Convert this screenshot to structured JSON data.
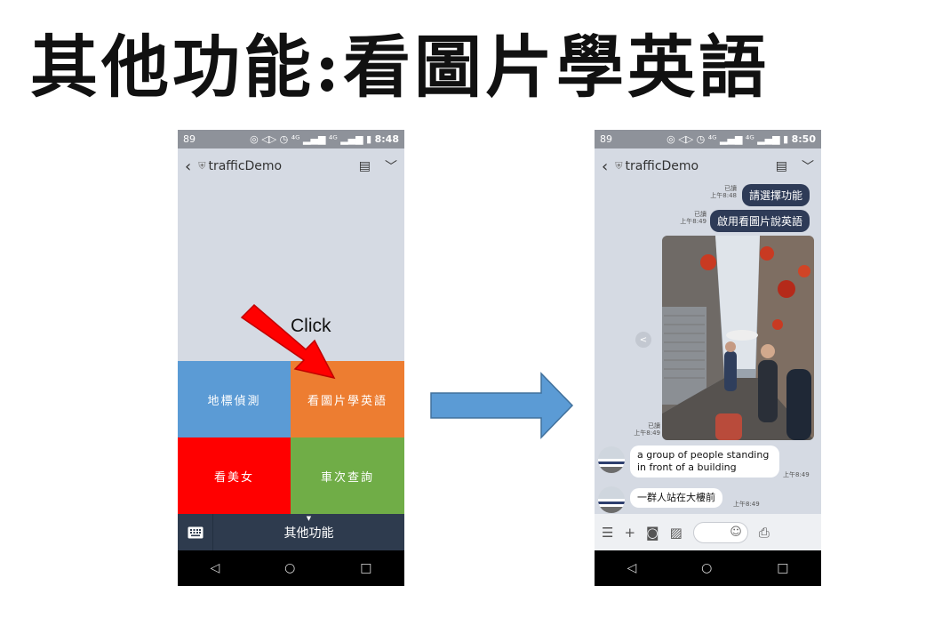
{
  "slide": {
    "title": "其他功能:看圖片學英語"
  },
  "annotation": {
    "click_text": "Click"
  },
  "left_phone": {
    "status": {
      "battery_left": "89",
      "icons": "◎ ◁▷ ◷ ⁴ᴳ ▂▄▆ ⁴ᴳ ▂▄▆ ▮",
      "time": "8:48"
    },
    "header": {
      "back": "‹",
      "shield": "⛨",
      "title": "trafficDemo",
      "note_icon": "▤",
      "chevron": "﹀"
    },
    "menu": [
      {
        "label": "地標偵測",
        "color": "#5b9bd5"
      },
      {
        "label": "看圖片學英語",
        "color": "#ed7d31"
      },
      {
        "label": "看美女",
        "color": "#ff0000"
      },
      {
        "label": "車次查詢",
        "color": "#70ad47"
      }
    ],
    "menu_bar": {
      "label": "其他功能",
      "caret": "▼"
    },
    "nav": {
      "back": "◁",
      "home": "○",
      "recent": "□"
    }
  },
  "right_phone": {
    "status": {
      "battery_left": "89",
      "icons": "◎ ◁▷ ◷ ⁴ᴳ ▂▄▆ ⁴ᴳ ▂▄▆ ▮",
      "time": "8:50"
    },
    "header": {
      "back": "‹",
      "shield": "⛨",
      "title": "trafficDemo",
      "note_icon": "▤",
      "chevron": "﹀"
    },
    "messages": {
      "m1": {
        "text": "請選擇功能",
        "read": "已讀",
        "time": "上午8:48"
      },
      "m2": {
        "text": "啟用看圖片說英語",
        "read": "已讀",
        "time": "上午8:49"
      },
      "photo": {
        "read": "已讀",
        "time": "上午8:49"
      },
      "reply1": {
        "text": "a group of people standing in front of a building",
        "time": "上午8:49"
      },
      "reply2": {
        "text": "一群人站在大樓前",
        "time": "上午8:49"
      }
    },
    "input": {
      "menu_icon": "☰",
      "plus_icon": "+",
      "camera_icon": "◙",
      "image_icon": "▨",
      "emoji_icon": "☺",
      "mic_icon": "⎙"
    },
    "nav": {
      "back": "◁",
      "home": "○",
      "recent": "□"
    }
  },
  "colors": {
    "phone_bg": "#d5dae3",
    "menu_bar": "#2e3b4e",
    "arrow_red": "#ff0000",
    "arrow_blue": "#5b9bd5"
  }
}
